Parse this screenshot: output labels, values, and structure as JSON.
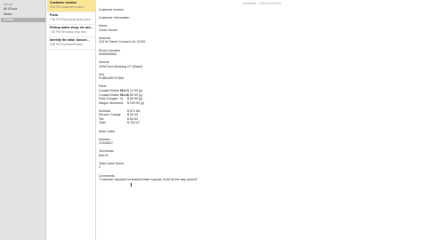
{
  "sidebar": {
    "section": "iCloud",
    "items": [
      {
        "label": "All iCloud"
      },
      {
        "label": "Notes"
      },
      {
        "label": "Quotes"
      }
    ]
  },
  "notes": [
    {
      "title": "Customer invoice",
      "subtitle": "9:44 PM  Customer Invoice..."
    },
    {
      "title": "Pizza",
      "subtitle": "7:35 PM  Pizza pizza pizza pizza"
    },
    {
      "title": "Pickup autos shop, we ass...",
      "subtitle": "7:18 PM  Set autos shop tow..."
    },
    {
      "title": "Identify the data: docum...",
      "subtitle": "5:55 PM  Document/Notes"
    }
  ],
  "editor": {
    "date": "December 7, 2016 at 9:44 PM",
    "lines": [
      "Customer invoice",
      "",
      "Customer Information",
      "",
      "Name",
      "Greta Herold",
      "",
      "Address",
      "123 W Street Concord CA 12345",
      "",
      "Phone Number",
      "5555555555",
      "",
      "Vehicle",
      "1998 Ford Mustang GT (Black)",
      "",
      "VIN",
      "FGBB4557S7866",
      "",
      "Parts"
    ],
    "parts": [
      {
        "name": "Coolant Brake Fluid",
        "qty": "x1",
        "price": "$ 12.99 (p)"
      },
      {
        "name": "Coolant Brake Fluids",
        "qty": "x1",
        "price": "$ 89.95 (p)"
      },
      {
        "name": "Fluid Gauges",
        "qty": "x1",
        "price": "$ 89.99 (p)"
      },
      {
        "name": "Wagon Mounts",
        "qty": "x1",
        "price": "$ 239.99 (p)"
      }
    ],
    "totals": [
      {
        "label": "Subtotal",
        "value": "$ 872.88"
      },
      {
        "label": "Service Charge",
        "value": "$ 60.20"
      },
      {
        "label": "Tax",
        "value": "$ 80.63"
      },
      {
        "label": "Total",
        "value": "$ 753.47"
      }
    ],
    "lines2": [
      "Work Order",
      "",
      "Number",
      "12345637",
      "",
      "Technician",
      "Bob M.",
      "",
      "Total Labor Hours",
      "2",
      "",
      "Comments",
      "\"Customer reported increased brake squeak, fixed all the way around\""
    ]
  }
}
